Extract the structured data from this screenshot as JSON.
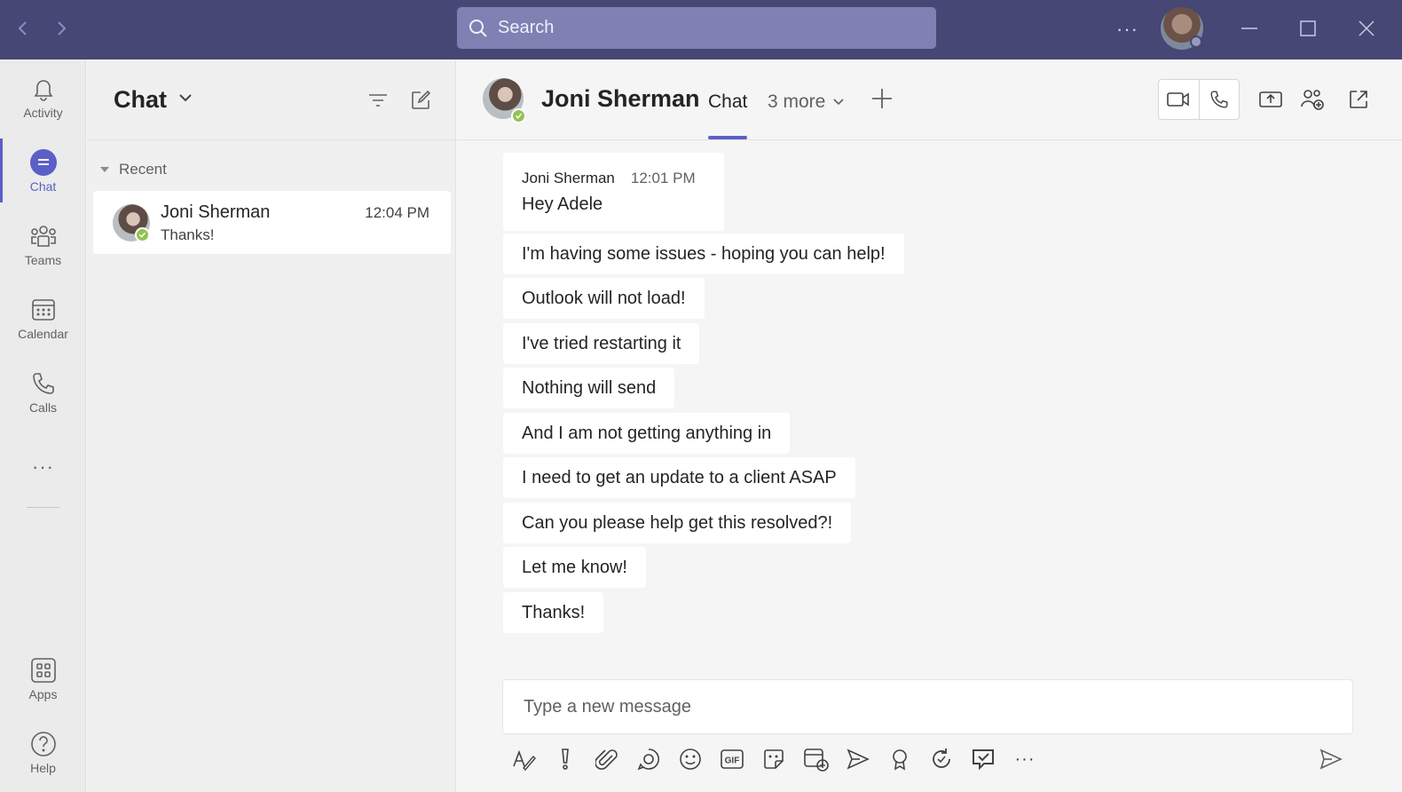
{
  "titlebar": {
    "search_placeholder": "Search",
    "more_label": "···"
  },
  "rail": {
    "items": [
      {
        "label": "Activity",
        "icon": "bell-icon"
      },
      {
        "label": "Chat",
        "icon": "chat-icon",
        "active": true
      },
      {
        "label": "Teams",
        "icon": "teams-icon"
      },
      {
        "label": "Calendar",
        "icon": "calendar-icon"
      },
      {
        "label": "Calls",
        "icon": "phone-icon"
      },
      {
        "label": "···",
        "icon": "more-icon"
      },
      {
        "label": "Apps",
        "icon": "apps-icon"
      },
      {
        "label": "Help",
        "icon": "help-icon"
      }
    ]
  },
  "list": {
    "title": "Chat",
    "section": "Recent",
    "chats": [
      {
        "name": "Joni Sherman",
        "time": "12:04 PM",
        "preview": "Thanks!"
      }
    ]
  },
  "main": {
    "contact_name": "Joni Sherman",
    "tab_active": "Chat",
    "more_tabs": "3 more",
    "messages": [
      {
        "author": "Joni Sherman",
        "time": "12:01 PM",
        "text": "Hey Adele"
      },
      {
        "text": "I'm having some issues - hoping you can help!"
      },
      {
        "text": "Outlook will not load!"
      },
      {
        "text": "I've tried restarting it"
      },
      {
        "text": "Nothing will send"
      },
      {
        "text": "And I am not getting anything in"
      },
      {
        "text": "I need to get an update to a client ASAP"
      },
      {
        "text": "Can you please help get this resolved?!"
      },
      {
        "text": "Let me know!"
      },
      {
        "text": "Thanks!"
      }
    ],
    "compose_placeholder": "Type a new message",
    "toolbar_gif_label": "GIF",
    "toolbar_more_label": "···"
  },
  "colors": {
    "titlebar": "#464775",
    "accent": "#5b5fc7",
    "presence_available": "#92c353"
  }
}
